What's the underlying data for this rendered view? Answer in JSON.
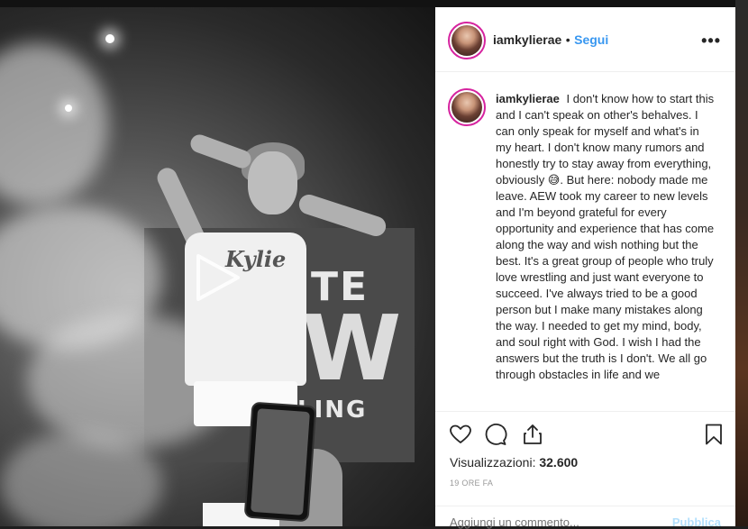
{
  "post": {
    "username": "iamkylierae",
    "separator": "•",
    "follow_label": "Segui",
    "more_label": "•••"
  },
  "photo": {
    "shirt_text": "Kylie",
    "banner_lines": [
      "TE",
      "W",
      "LING"
    ]
  },
  "caption": {
    "username": "iamkylierae",
    "text": "I don't know how to start this and I can't speak on other's behalves. I can only speak for myself and what's in my heart. I don't know many rumors and honestly try to stay away from everything, obviously 😅. But here: nobody made me leave. AEW took my career to new levels and I'm beyond grateful for every opportunity and experience that has come along the way and wish nothing but the best. It's a great group of people who truly love wrestling and just want everyone to succeed. I've always tried to be a good person but I make many mistakes along the way. I needed to get my mind, body, and soul right with God. I wish I had the answers but the truth is I don't. We all go through obstacles in life and we"
  },
  "stats": {
    "views_label": "Visualizzazioni:",
    "views_value": "32.600",
    "timestamp": "19 ORE FA"
  },
  "comment": {
    "placeholder": "Aggiungi un commento...",
    "publish_label": "Pubblica"
  },
  "icons": [
    "heart-icon",
    "comment-icon",
    "share-icon",
    "bookmark-icon",
    "play-icon",
    "more-icon"
  ],
  "colors": {
    "accent": "#3897f0",
    "publish_disabled": "#b2dffc",
    "text": "#262626",
    "muted": "#999999",
    "story_ring": "#d6249f"
  }
}
